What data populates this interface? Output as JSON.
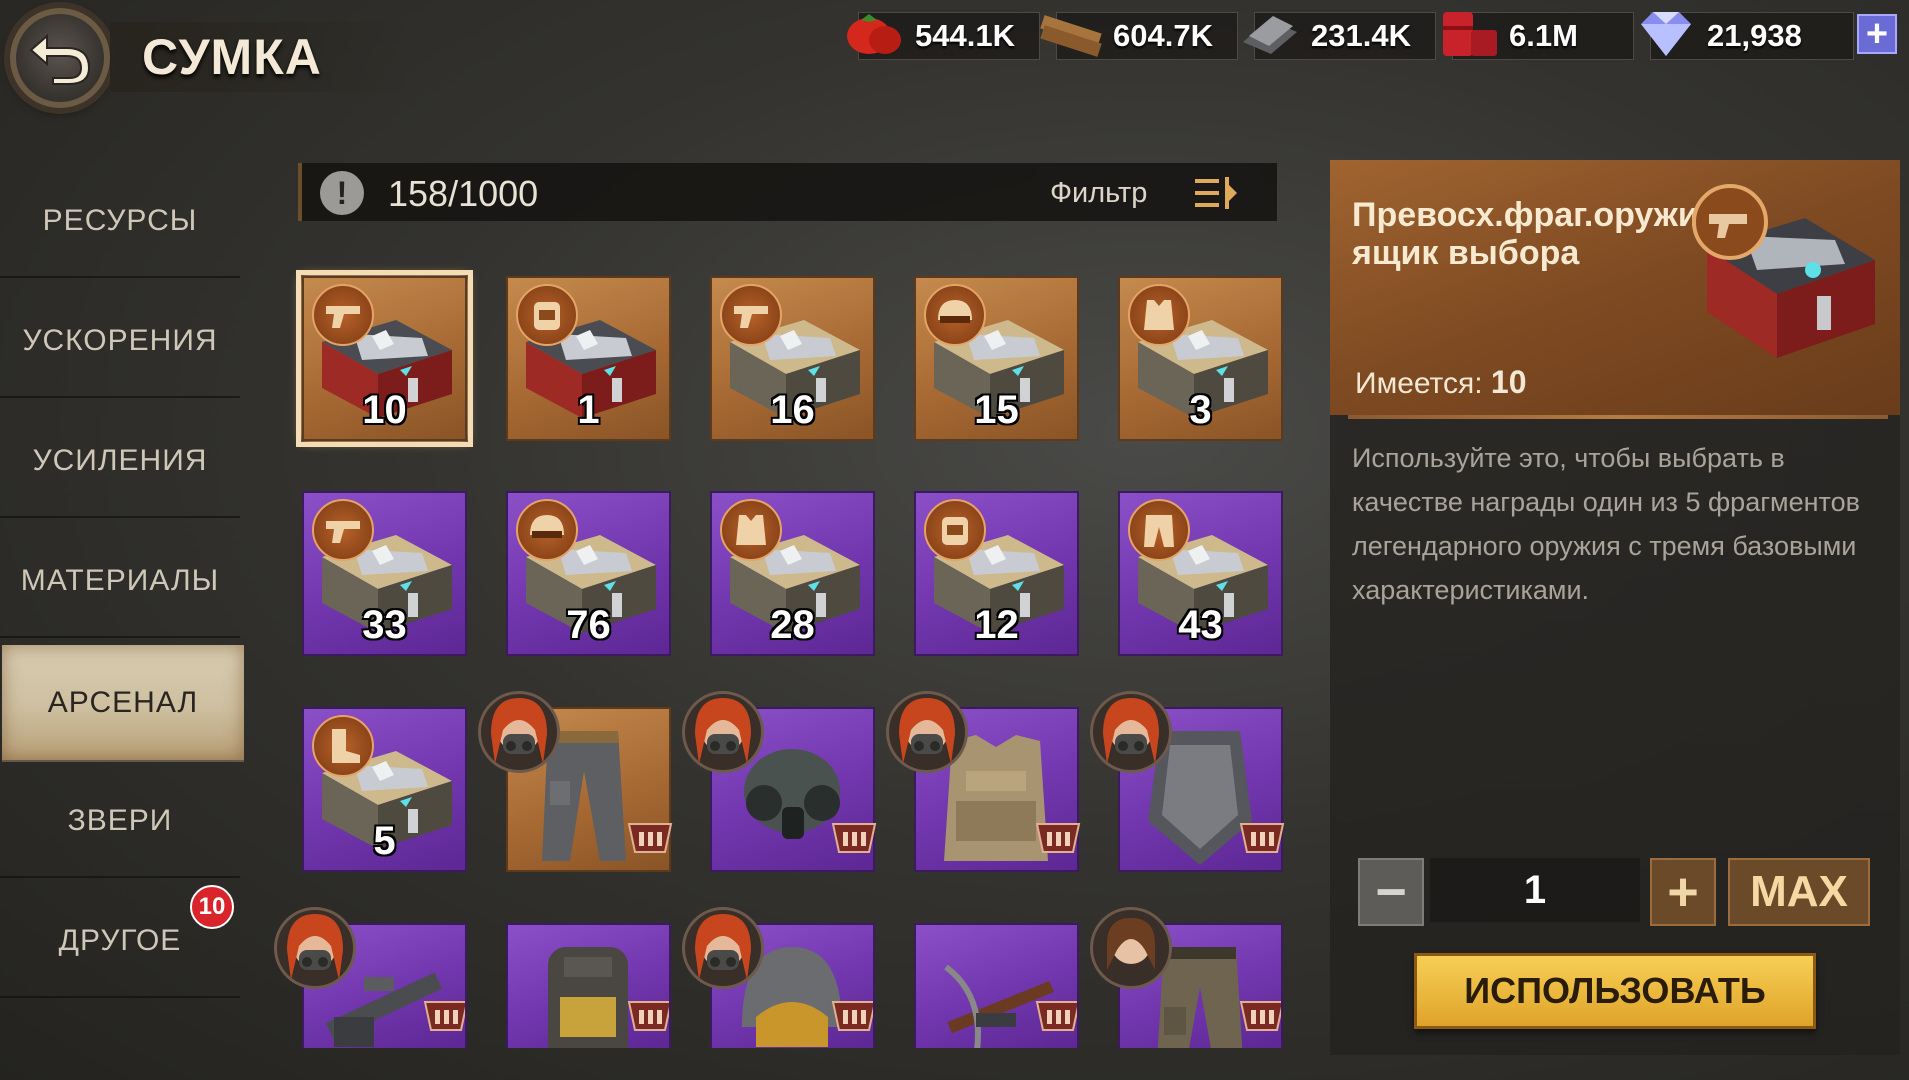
{
  "header": {
    "title": "СУМКА",
    "resources": [
      {
        "icon": "tomato-food-icon",
        "value": "544.1K"
      },
      {
        "icon": "wood-planks-icon",
        "value": "604.7K"
      },
      {
        "icon": "steel-bars-icon",
        "value": "231.4K"
      },
      {
        "icon": "oil-barrel-icon",
        "value": "6.1M"
      },
      {
        "icon": "diamond-gems-icon",
        "value": "21,938"
      }
    ],
    "plus_label": "+"
  },
  "sidebar": {
    "items": [
      {
        "label": "РЕСУРСЫ"
      },
      {
        "label": "УСКОРЕНИЯ"
      },
      {
        "label": "УСИЛЕНИЯ"
      },
      {
        "label": "МАТЕРИАЛЫ"
      },
      {
        "label": "АРСЕНАЛ"
      },
      {
        "label": "ЗВЕРИ"
      },
      {
        "label": "ДРУГОЕ"
      }
    ],
    "active": "АРСЕНАЛ",
    "other_badge": "10"
  },
  "inventory": {
    "capacity": "158/1000",
    "warn_glyph": "!",
    "filter_label": "Фильтр",
    "rows": [
      [
        {
          "kind": "chest",
          "style": "red",
          "bg": "orange",
          "category": "pistol",
          "count": "10"
        },
        {
          "kind": "chest",
          "style": "red",
          "bg": "orange",
          "category": "backpack",
          "count": "1"
        },
        {
          "kind": "chest",
          "style": "gold",
          "bg": "orange",
          "category": "pistol",
          "count": "16"
        },
        {
          "kind": "chest",
          "style": "gold",
          "bg": "orange",
          "category": "helmet",
          "count": "15"
        },
        {
          "kind": "chest",
          "style": "gold",
          "bg": "orange",
          "category": "vest",
          "count": "3"
        }
      ],
      [
        {
          "kind": "chest",
          "style": "gold",
          "bg": "purple",
          "category": "pistol",
          "count": "33"
        },
        {
          "kind": "chest",
          "style": "gold",
          "bg": "purple",
          "category": "helmet",
          "count": "76"
        },
        {
          "kind": "chest",
          "style": "gold",
          "bg": "purple",
          "category": "vest",
          "count": "28"
        },
        {
          "kind": "chest",
          "style": "gold",
          "bg": "purple",
          "category": "backpack",
          "count": "12"
        },
        {
          "kind": "chest",
          "style": "gold",
          "bg": "purple",
          "category": "pants",
          "count": "43"
        }
      ],
      [
        {
          "kind": "chest",
          "style": "gold",
          "bg": "purple",
          "category": "boots",
          "count": "5"
        },
        {
          "kind": "gear",
          "bg": "orange",
          "item": "cargo-pants",
          "hero": "masked"
        },
        {
          "kind": "gear",
          "bg": "purple",
          "item": "gas-mask",
          "hero": "masked"
        },
        {
          "kind": "gear",
          "bg": "purple",
          "item": "tactical-vest",
          "hero": "masked"
        },
        {
          "kind": "gear",
          "bg": "purple",
          "item": "armored-shield",
          "hero": "masked"
        }
      ],
      [
        {
          "kind": "gear",
          "bg": "purple",
          "item": "machine-gun",
          "hero": "masked"
        },
        {
          "kind": "gear",
          "bg": "purple",
          "item": "backpack"
        },
        {
          "kind": "gear",
          "bg": "purple",
          "item": "helmet",
          "hero": "masked"
        },
        {
          "kind": "gear",
          "bg": "purple",
          "item": "crossbow"
        },
        {
          "kind": "gear",
          "bg": "purple",
          "item": "tactical-pants",
          "hero": "girl"
        }
      ]
    ]
  },
  "detail": {
    "name": "Превосх.фраг.оружия, ящик выбора",
    "owned_label": "Имеется:",
    "owned_value": "10",
    "description": "Используйте это, чтобы выбрать в качестве награды один из 5 фрагментов легендарного оружия с тремя базовыми характеристиками.",
    "minus": "−",
    "quantity": "1",
    "plus": "+",
    "max_label": "MAX",
    "use_label": "ИСПОЛЬЗОВАТЬ"
  }
}
